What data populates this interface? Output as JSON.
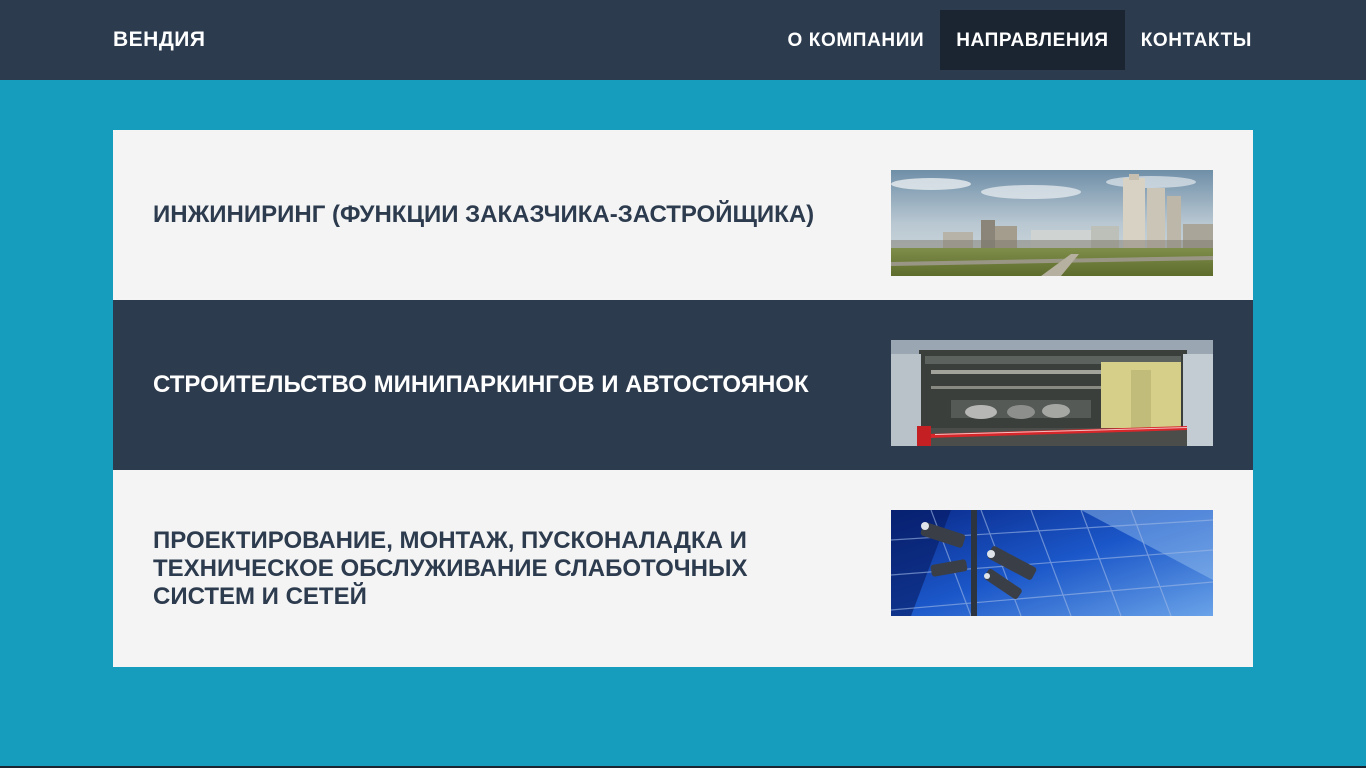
{
  "header": {
    "logo": "ВЕНДИЯ",
    "nav": [
      {
        "label": "О КОМПАНИИ",
        "active": false
      },
      {
        "label": "НАПРАВЛЕНИЯ",
        "active": true
      },
      {
        "label": "КОНТАКТЫ",
        "active": false
      }
    ]
  },
  "directions": [
    {
      "title": "ИНЖИНИРИНГ (ФУНКЦИИ ЗАКАЗЧИКА-ЗАСТРОЙЩИКА)"
    },
    {
      "title": "СТРОИТЕЛЬСТВО МИНИПАРКИНГОВ И АВТОСТОЯНОК"
    },
    {
      "title": "ПРОЕКТИРОВАНИЕ, МОНТАЖ, ПУСКОНАЛАДКА И ТЕХНИЧЕСКОЕ ОБСЛУЖИВАНИЕ СЛАБОТОЧНЫХ СИСТЕМ И СЕТЕЙ"
    }
  ],
  "colors": {
    "page_bg": "#169cbd",
    "header_bg": "#2d3b4e",
    "nav_active_bg": "#1b2532",
    "card_light": "#f4f4f4",
    "card_dark": "#2d3b4e"
  }
}
